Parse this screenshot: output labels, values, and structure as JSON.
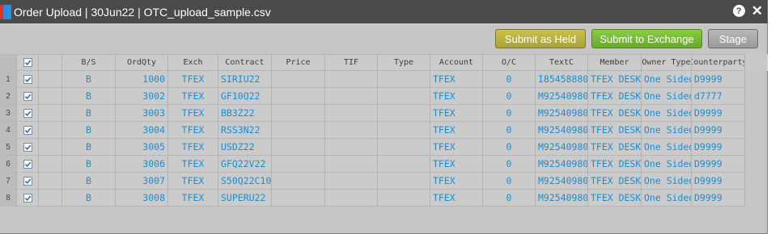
{
  "window": {
    "title": "Order Upload | 30Jun22 | OTC_upload_sample.csv",
    "help_label": "?",
    "close_label": "✕"
  },
  "toolbar": {
    "submit_held_label": "Submit as Held",
    "submit_exchange_label": "Submit to Exchange",
    "stage_label": "Stage"
  },
  "columns": [
    "B/S",
    "OrdQty",
    "Exch",
    "Contract",
    "Price",
    "TIF",
    "Type",
    "Account",
    "O/C",
    "TextC",
    "Member",
    "Owner Type",
    "Counterparty"
  ],
  "rows": [
    {
      "num": "1",
      "checked": true,
      "bs": "B",
      "qty": "1000",
      "exch": "TFEX",
      "contract": "SIRIU22",
      "price": "",
      "tif": "",
      "type": "",
      "account": "TFEX",
      "oc": "0",
      "textc": "I85458880",
      "member": "TFEX DESK",
      "owner": "One Sided",
      "cp": "D9999"
    },
    {
      "num": "2",
      "checked": true,
      "bs": "B",
      "qty": "3002",
      "exch": "TFEX",
      "contract": "GF10Q22",
      "price": "",
      "tif": "",
      "type": "",
      "account": "TFEX",
      "oc": "0",
      "textc": "M92540980",
      "member": "TFEX DESK",
      "owner": "One Sided",
      "cp": "d7777"
    },
    {
      "num": "3",
      "checked": true,
      "bs": "B",
      "qty": "3003",
      "exch": "TFEX",
      "contract": "BB3Z22",
      "price": "",
      "tif": "",
      "type": "",
      "account": "TFEX",
      "oc": "0",
      "textc": "M92540980",
      "member": "TFEX DESK",
      "owner": "One Sided",
      "cp": "D9999"
    },
    {
      "num": "4",
      "checked": true,
      "bs": "B",
      "qty": "3004",
      "exch": "TFEX",
      "contract": "RSS3N22",
      "price": "",
      "tif": "",
      "type": "",
      "account": "TFEX",
      "oc": "0",
      "textc": "M92540980",
      "member": "TFEX DESK",
      "owner": "One Sided",
      "cp": "D9999"
    },
    {
      "num": "5",
      "checked": true,
      "bs": "B",
      "qty": "3005",
      "exch": "TFEX",
      "contract": "USDZ22",
      "price": "",
      "tif": "",
      "type": "",
      "account": "TFEX",
      "oc": "0",
      "textc": "M92540980",
      "member": "TFEX DESK",
      "owner": "One Sided",
      "cp": "D9999"
    },
    {
      "num": "6",
      "checked": true,
      "bs": "B",
      "qty": "3006",
      "exch": "TFEX",
      "contract": "GFQ22V22",
      "price": "",
      "tif": "",
      "type": "",
      "account": "TFEX",
      "oc": "0",
      "textc": "M92540980",
      "member": "TFEX DESK",
      "owner": "One Sided",
      "cp": "D9999"
    },
    {
      "num": "7",
      "checked": true,
      "bs": "B",
      "qty": "3007",
      "exch": "TFEX",
      "contract": "S50Q22C10",
      "price": "",
      "tif": "",
      "type": "",
      "account": "TFEX",
      "oc": "0",
      "textc": "M92540980",
      "member": "TFEX DESK",
      "owner": "One Sided",
      "cp": "D9999"
    },
    {
      "num": "8",
      "checked": true,
      "bs": "B",
      "qty": "3008",
      "exch": "TFEX",
      "contract": "SUPERU22",
      "price": "",
      "tif": "",
      "type": "",
      "account": "TFEX",
      "oc": "0",
      "textc": "M92540980",
      "member": "TFEX DESK",
      "owner": "One Sided",
      "cp": "D9999"
    }
  ],
  "icons": {
    "app": "order-upload-icon",
    "help": "help-icon",
    "close": "close-icon",
    "check": "checkbox-check-icon"
  },
  "colors": {
    "titlebar": "#4a4a4a",
    "cell_text": "#1a8fd0",
    "held_button": "#b8b240",
    "exchange_button": "#7abb38",
    "stage_button": "#a8a8a8"
  }
}
